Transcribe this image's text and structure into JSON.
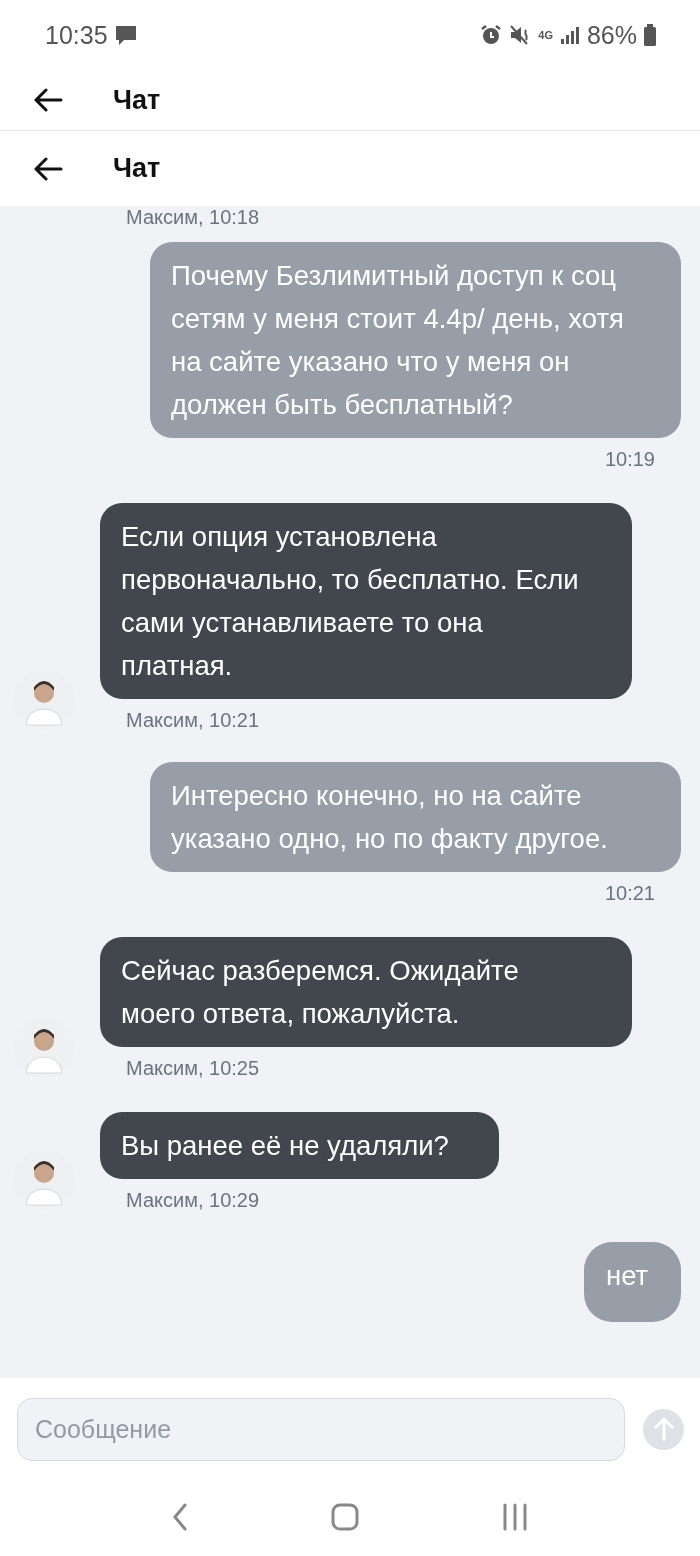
{
  "status_bar": {
    "time": "10:35",
    "battery": "86%",
    "network": "4G"
  },
  "app_bars": [
    {
      "title": "Чат"
    },
    {
      "title": "Чат"
    }
  ],
  "messages": [
    {
      "kind": "incoming_meta",
      "meta": "Максим, 10:18"
    },
    {
      "kind": "outgoing",
      "text": "Почему Безлимитный доступ к соц сетям у меня стоит 4.4р/ день, хотя на сайте указано что у меня он должен быть бесплатный?",
      "meta": "10:19"
    },
    {
      "kind": "incoming",
      "text": "Если опция установлена первоначально, то бесплатно. Если сами устанавливаете то она платная.",
      "meta": "Максим, 10:21"
    },
    {
      "kind": "outgoing",
      "text": "Интересно конечно, но на сайте указано одно, но по факту другое.",
      "meta": "10:21"
    },
    {
      "kind": "incoming",
      "text": "Сейчас разберемся. Ожидайте моего ответа, пожалуйста.",
      "meta": "Максим, 10:25"
    },
    {
      "kind": "incoming",
      "text": "Вы ранее её не удаляли?",
      "meta": "Максим, 10:29"
    },
    {
      "kind": "outgoing_cut",
      "text": "нет"
    }
  ],
  "composer": {
    "placeholder": "Сообщение"
  }
}
